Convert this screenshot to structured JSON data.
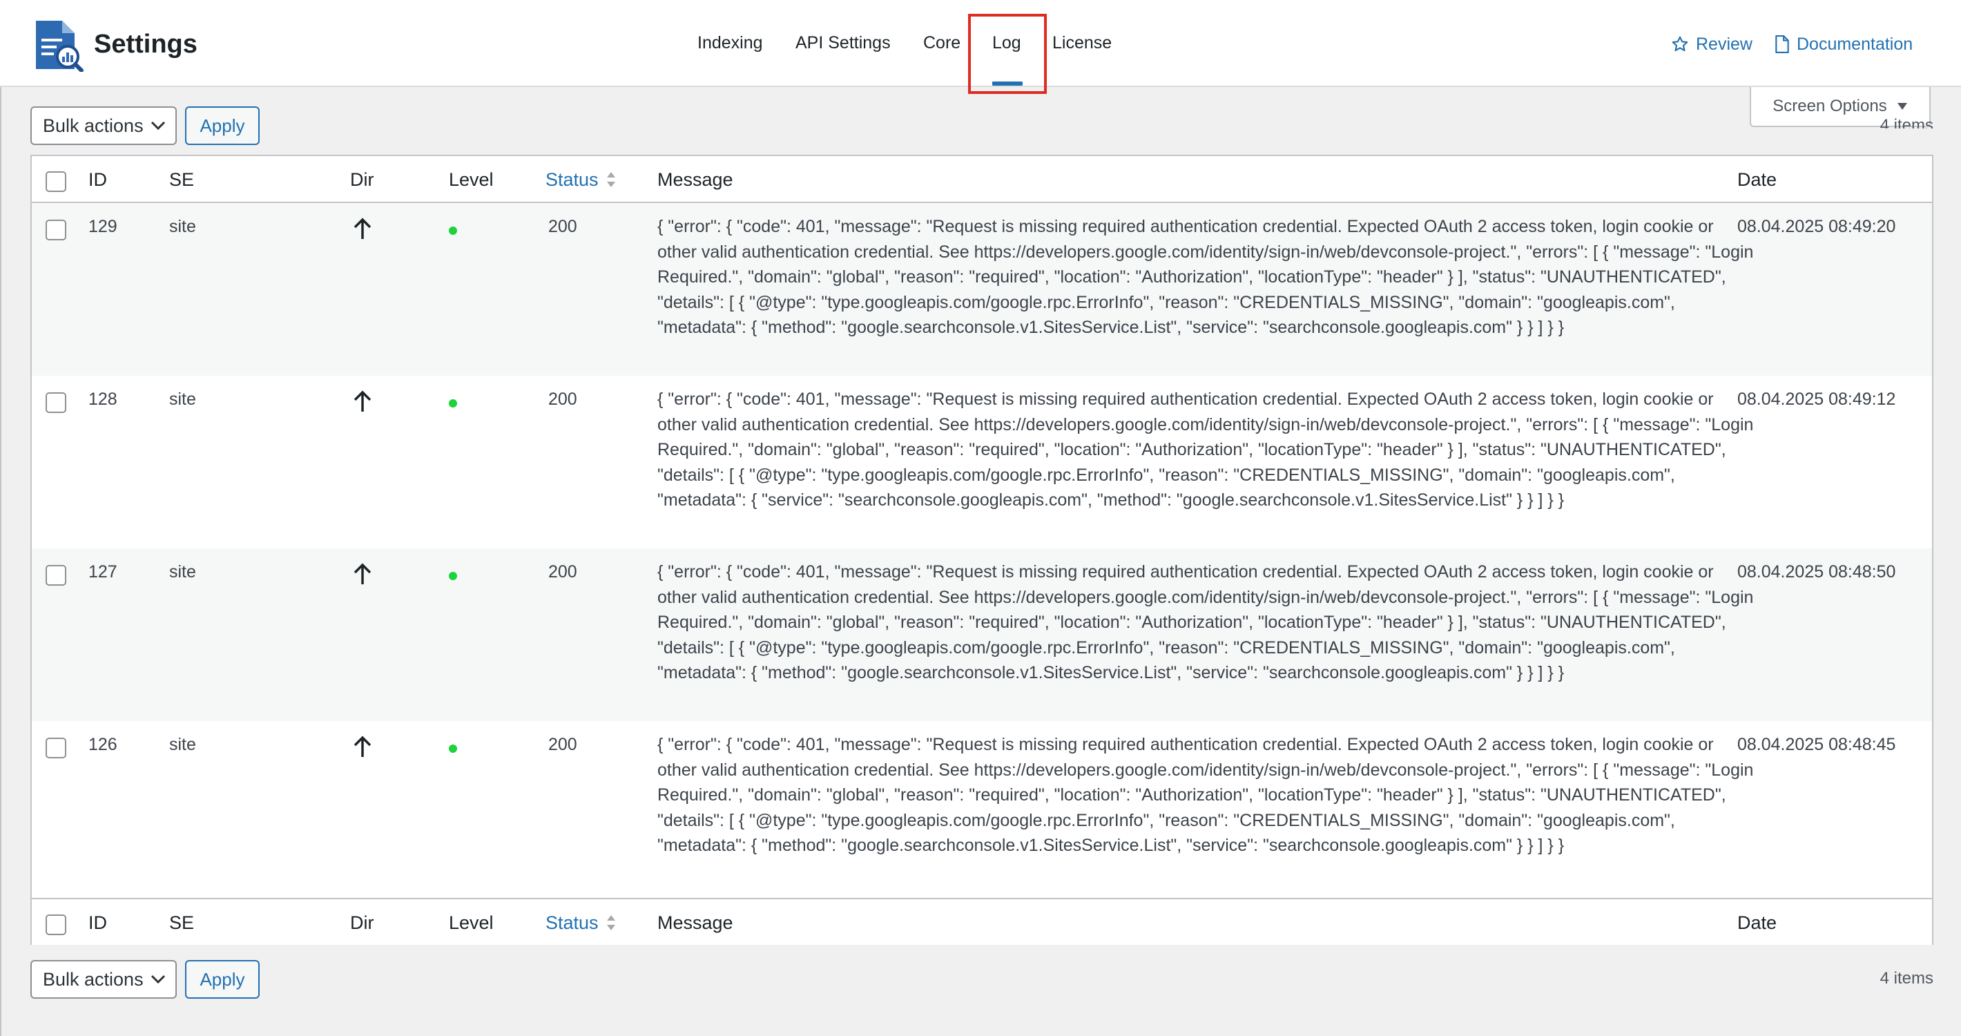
{
  "header": {
    "title": "Settings",
    "tabs": [
      {
        "label": "Indexing"
      },
      {
        "label": "API Settings"
      },
      {
        "label": "Core"
      },
      {
        "label": "Log",
        "active": true
      },
      {
        "label": "License"
      }
    ],
    "review_label": "Review",
    "documentation_label": "Documentation"
  },
  "screen_options": {
    "label": "Screen Options"
  },
  "top_nav": {
    "bulk_actions": "Bulk actions",
    "apply": "Apply",
    "items_count": "4 items"
  },
  "bottom_nav": {
    "bulk_actions": "Bulk actions",
    "apply": "Apply",
    "items_count": "4 items"
  },
  "table": {
    "columns": {
      "id": "ID",
      "se": "SE",
      "dir": "Dir",
      "level": "Level",
      "status": "Status",
      "message": "Message",
      "date": "Date"
    },
    "rows": [
      {
        "id": "129",
        "se": "site",
        "dir_icon": "arrow-up-icon",
        "level_color": "#1cd43a",
        "status": "200",
        "message": "{ \"error\": { \"code\": 401, \"message\": \"Request is missing required authentication credential. Expected OAuth 2 access token, login cookie or other valid authentication credential. See https://developers.google.com/identity/sign-in/web/devconsole-project.\", \"errors\": [ { \"message\": \"Login Required.\", \"domain\": \"global\", \"reason\": \"required\", \"location\": \"Authorization\", \"locationType\": \"header\" } ], \"status\": \"UNAUTHENTICATED\", \"details\": [ { \"@type\": \"type.googleapis.com/google.rpc.ErrorInfo\", \"reason\": \"CREDENTIALS_MISSING\", \"domain\": \"googleapis.com\", \"metadata\": { \"method\": \"google.searchconsole.v1.SitesService.List\", \"service\": \"searchconsole.googleapis.com\" } } ] } }",
        "date": "08.04.2025 08:49:20"
      },
      {
        "id": "128",
        "se": "site",
        "dir_icon": "arrow-up-icon",
        "level_color": "#1cd43a",
        "status": "200",
        "message": "{ \"error\": { \"code\": 401, \"message\": \"Request is missing required authentication credential. Expected OAuth 2 access token, login cookie or other valid authentication credential. See https://developers.google.com/identity/sign-in/web/devconsole-project.\", \"errors\": [ { \"message\": \"Login Required.\", \"domain\": \"global\", \"reason\": \"required\", \"location\": \"Authorization\", \"locationType\": \"header\" } ], \"status\": \"UNAUTHENTICATED\", \"details\": [ { \"@type\": \"type.googleapis.com/google.rpc.ErrorInfo\", \"reason\": \"CREDENTIALS_MISSING\", \"domain\": \"googleapis.com\", \"metadata\": { \"service\": \"searchconsole.googleapis.com\", \"method\": \"google.searchconsole.v1.SitesService.List\" } } ] } }",
        "date": "08.04.2025 08:49:12"
      },
      {
        "id": "127",
        "se": "site",
        "dir_icon": "arrow-up-icon",
        "level_color": "#1cd43a",
        "status": "200",
        "message": "{ \"error\": { \"code\": 401, \"message\": \"Request is missing required authentication credential. Expected OAuth 2 access token, login cookie or other valid authentication credential. See https://developers.google.com/identity/sign-in/web/devconsole-project.\", \"errors\": [ { \"message\": \"Login Required.\", \"domain\": \"global\", \"reason\": \"required\", \"location\": \"Authorization\", \"locationType\": \"header\" } ], \"status\": \"UNAUTHENTICATED\", \"details\": [ { \"@type\": \"type.googleapis.com/google.rpc.ErrorInfo\", \"reason\": \"CREDENTIALS_MISSING\", \"domain\": \"googleapis.com\", \"metadata\": { \"method\": \"google.searchconsole.v1.SitesService.List\", \"service\": \"searchconsole.googleapis.com\" } } ] } }",
        "date": "08.04.2025 08:48:50"
      },
      {
        "id": "126",
        "se": "site",
        "dir_icon": "arrow-up-icon",
        "level_color": "#1cd43a",
        "status": "200",
        "message": "{ \"error\": { \"code\": 401, \"message\": \"Request is missing required authentication credential. Expected OAuth 2 access token, login cookie or other valid authentication credential. See https://developers.google.com/identity/sign-in/web/devconsole-project.\", \"errors\": [ { \"message\": \"Login Required.\", \"domain\": \"global\", \"reason\": \"required\", \"location\": \"Authorization\", \"locationType\": \"header\" } ], \"status\": \"UNAUTHENTICATED\", \"details\": [ { \"@type\": \"type.googleapis.com/google.rpc.ErrorInfo\", \"reason\": \"CREDENTIALS_MISSING\", \"domain\": \"googleapis.com\", \"metadata\": { \"method\": \"google.searchconsole.v1.SitesService.List\", \"service\": \"searchconsole.googleapis.com\" } } ] } }",
        "date": "08.04.2025 08:48:45"
      }
    ]
  },
  "colors": {
    "accent": "#2271b1",
    "highlight": "#e02b20",
    "level_ok": "#1cd43a"
  }
}
